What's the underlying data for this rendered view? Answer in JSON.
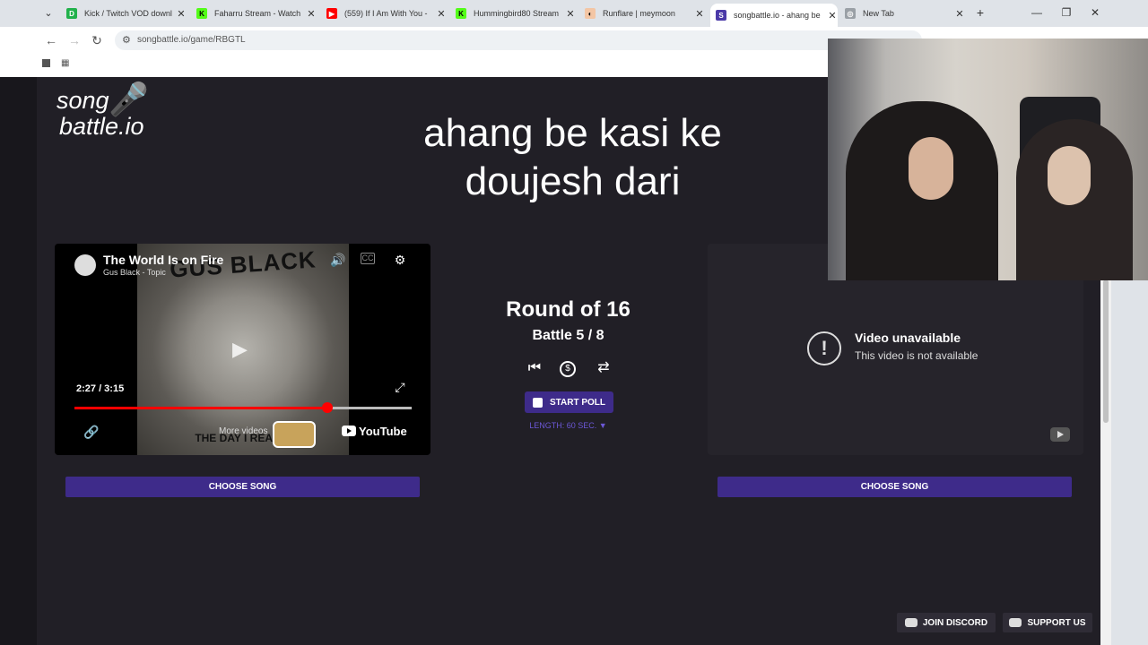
{
  "browser": {
    "tabs": [
      {
        "title": "Kick / Twitch VOD downl",
        "fav_color": "#21b14b",
        "fav_text": "D"
      },
      {
        "title": "Faharru Stream - Watch",
        "fav_color": "#53fc18",
        "fav_text": "K"
      },
      {
        "title": "(559) If I Am With You -",
        "fav_color": "#ff0000",
        "fav_text": "▶"
      },
      {
        "title": "Hummingbird80 Stream",
        "fav_color": "#53fc18",
        "fav_text": "K"
      },
      {
        "title": "Runflare | meymoon",
        "fav_color": "#f3c6a5",
        "fav_text": "◐"
      },
      {
        "title": "songbattle.io - ahang be",
        "fav_color": "#4b3aa8",
        "fav_text": "S"
      },
      {
        "title": "New Tab",
        "fav_color": "#9aa0a6",
        "fav_text": "◎"
      }
    ],
    "url": "songbattle.io/game/RBGTL"
  },
  "site": {
    "logo_line1": "song",
    "logo_line2": "battle.io",
    "title": "ahang be kasi ke doujesh dari"
  },
  "left_video": {
    "title": "The World Is on Fire",
    "channel": "Gus Black - Topic",
    "cover_band": "GUS BLACK",
    "cover_sub": "THE DAY I REALI...",
    "time": "2:27 / 3:15",
    "progress": 0.75,
    "more_videos": "More videos",
    "youtube": "YouTube"
  },
  "center": {
    "round": "Round of 16",
    "battle": "Battle 5 / 8",
    "start_poll": "START POLL",
    "length": "LENGTH: 60 SEC. ▼"
  },
  "right_video": {
    "heading": "Video unavailable",
    "subtext": "This video is not available"
  },
  "buttons": {
    "choose_song": "CHOOSE SONG",
    "join_discord": "JOIN DISCORD",
    "support_us": "SUPPORT US"
  }
}
